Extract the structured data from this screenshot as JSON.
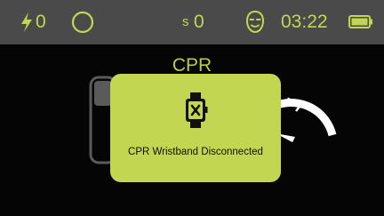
{
  "status_bar": {
    "shock_count": "0",
    "sync_count_prefix": "s",
    "sync_count": "0",
    "time": "03:22"
  },
  "main": {
    "title": "CPR"
  },
  "dialog": {
    "message": "CPR Wristband Disconnected",
    "icon": "wristband-disconnected-icon"
  },
  "colors": {
    "accent": "#c3d652",
    "status_bar_bg": "#4a4a4a",
    "screen_bg": "#050505"
  }
}
